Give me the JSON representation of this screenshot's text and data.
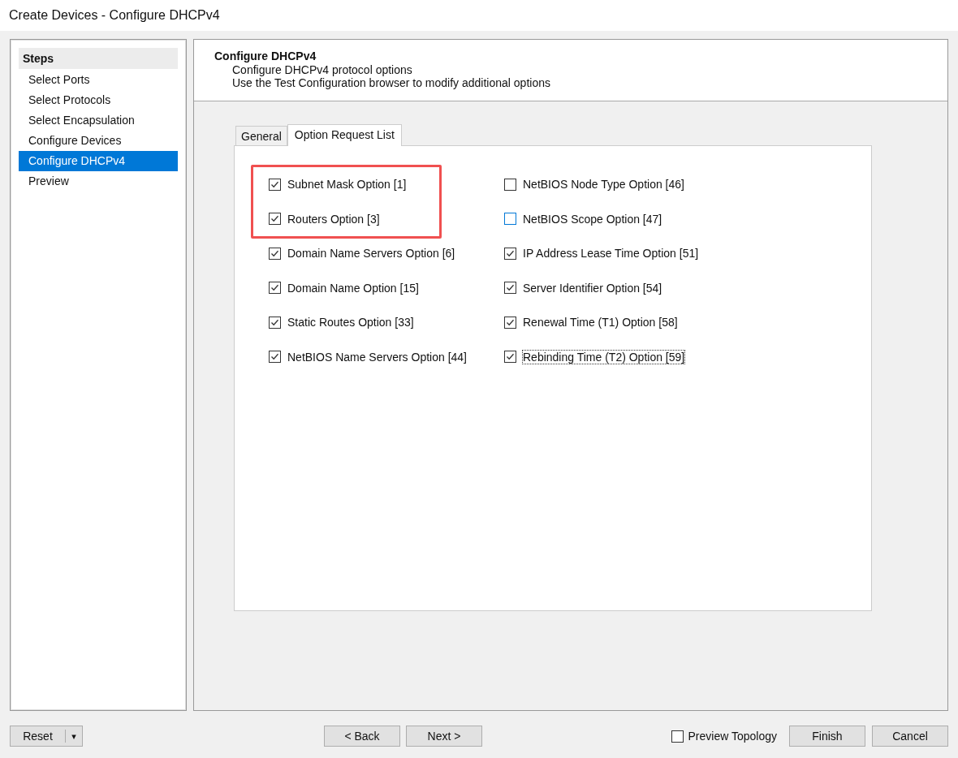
{
  "window": {
    "title": "Create Devices - Configure DHCPv4"
  },
  "steps": {
    "heading": "Steps",
    "items": [
      {
        "label": "Select Ports",
        "selected": false
      },
      {
        "label": "Select Protocols",
        "selected": false
      },
      {
        "label": "Select Encapsulation",
        "selected": false
      },
      {
        "label": "Configure Devices",
        "selected": false
      },
      {
        "label": "Configure DHCPv4",
        "selected": true
      },
      {
        "label": "Preview",
        "selected": false
      }
    ]
  },
  "header": {
    "title": "Configure DHCPv4",
    "lines": [
      "Configure DHCPv4 protocol options",
      "Use the Test Configuration browser to modify additional options"
    ]
  },
  "tabs": [
    {
      "label": "General",
      "selected": false
    },
    {
      "label": "Option Request List",
      "selected": true
    }
  ],
  "options": [
    [
      {
        "label": "Subnet Mask Option [1]",
        "checked": true,
        "highlighted": true
      },
      {
        "label": "Routers Option [3]",
        "checked": true,
        "highlighted": true
      },
      {
        "label": "Domain Name Servers Option [6]",
        "checked": true,
        "highlighted": false
      },
      {
        "label": "Domain Name Option [15]",
        "checked": true,
        "highlighted": false
      },
      {
        "label": "Static Routes Option [33]",
        "checked": true,
        "highlighted": false
      },
      {
        "label": "NetBIOS Name Servers Option [44]",
        "checked": true,
        "highlighted": false
      }
    ],
    [
      {
        "label": "NetBIOS Node Type Option [46]",
        "checked": false,
        "hovered": false,
        "focused": false
      },
      {
        "label": "NetBIOS Scope Option [47]",
        "checked": false,
        "hovered": true,
        "focused": false
      },
      {
        "label": "IP Address Lease Time Option [51]",
        "checked": true,
        "hovered": false,
        "focused": false
      },
      {
        "label": "Server Identifier Option [54]",
        "checked": true,
        "hovered": false,
        "focused": false
      },
      {
        "label": "Renewal Time (T1) Option [58]",
        "checked": true,
        "hovered": false,
        "focused": false
      },
      {
        "label": "Rebinding Time (T2) Option [59]",
        "checked": true,
        "hovered": false,
        "focused": true
      }
    ]
  ],
  "footer": {
    "reset": "Reset",
    "dropdown": "▾",
    "back": "< Back",
    "next": "Next >",
    "preview_topology": {
      "label": "Preview Topology",
      "checked": false
    },
    "finish": "Finish",
    "cancel": "Cancel"
  }
}
